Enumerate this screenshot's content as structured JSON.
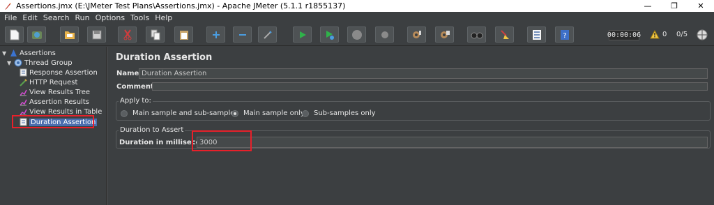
{
  "window": {
    "title": "Assertions.jmx (E:\\JMeter Test Plans\\Assertions.jmx) - Apache JMeter (5.1.1 r1855137)",
    "controls": [
      "—",
      "❐",
      "✕"
    ]
  },
  "menu": [
    "File",
    "Edit",
    "Search",
    "Run",
    "Options",
    "Tools",
    "Help"
  ],
  "toolbar": {
    "buttons": [
      "new",
      "templates",
      "open",
      "save",
      "cut",
      "copy",
      "paste",
      "expand",
      "collapse",
      "toggle",
      "start",
      "start-no-pauses",
      "stop",
      "shutdown",
      "clear",
      "clear-all",
      "search",
      "reset-search",
      "function-helper",
      "help"
    ],
    "timer": "00:00:06",
    "warning_count": "0",
    "threads": "0/5"
  },
  "tree": {
    "nodes": [
      {
        "label": "Assertions",
        "icon": "test-plan-icon",
        "level": 0,
        "expanded": true
      },
      {
        "label": "Thread Group",
        "icon": "gear-icon",
        "level": 1,
        "expanded": true
      },
      {
        "label": "Response Assertion",
        "icon": "assertion-icon",
        "level": 2
      },
      {
        "label": "HTTP Request",
        "icon": "pencil-icon",
        "level": 2
      },
      {
        "label": "View Results Tree",
        "icon": "chart-icon",
        "level": 2
      },
      {
        "label": "Assertion Results",
        "icon": "chart-icon",
        "level": 2
      },
      {
        "label": "View Results in Table",
        "icon": "chart-icon",
        "level": 2
      },
      {
        "label": "Duration Assertion",
        "icon": "assertion-icon",
        "level": 2,
        "selected": true
      }
    ]
  },
  "panel": {
    "title": "Duration Assertion",
    "name_label": "Name:",
    "name_value": "Duration Assertion",
    "comments_label": "Comments:",
    "comments_value": "",
    "apply_to": {
      "legend": "Apply to:",
      "options": [
        "Main sample and sub-samples",
        "Main sample only",
        "Sub-samples only"
      ],
      "selected": "Main sample only"
    },
    "duration": {
      "legend": "Duration to Assert",
      "label": "Duration in milliseconds:",
      "value": "3000"
    }
  },
  "colors": {
    "background": "#3c3f41",
    "selection": "#4b6eaf",
    "highlight_box": "#e8202a"
  }
}
